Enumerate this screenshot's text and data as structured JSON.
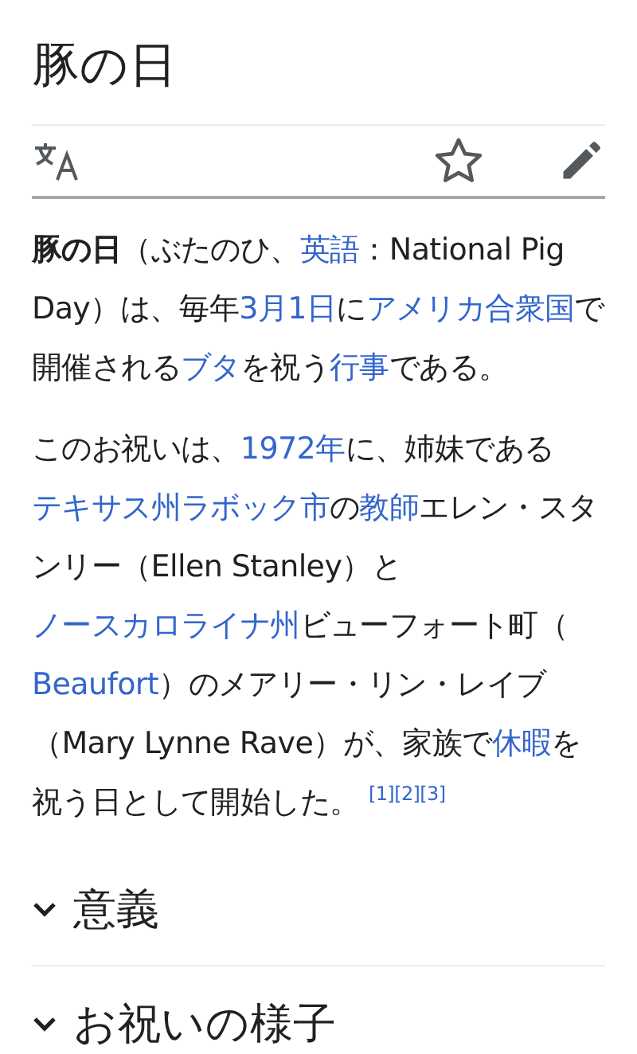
{
  "page_title": "豚の日",
  "toolbar": {
    "star": {
      "selected": false
    }
  },
  "paragraphs": [
    [
      {
        "kind": "bold",
        "text": "豚の日"
      },
      {
        "kind": "plain",
        "text": "（ぶたのひ、"
      },
      {
        "kind": "link",
        "text": "英語"
      },
      {
        "kind": "plain",
        "text": "：National Pig Day）は、毎年"
      },
      {
        "kind": "link",
        "text": "3月1日"
      },
      {
        "kind": "plain",
        "text": "に"
      },
      {
        "kind": "link",
        "text": "アメリカ合衆国"
      },
      {
        "kind": "plain",
        "text": "で開催される"
      },
      {
        "kind": "link",
        "text": "ブタ"
      },
      {
        "kind": "plain",
        "text": "を祝う"
      },
      {
        "kind": "link",
        "text": "行事"
      },
      {
        "kind": "plain",
        "text": "である。"
      }
    ],
    [
      {
        "kind": "plain",
        "text": "このお祝いは、"
      },
      {
        "kind": "link",
        "text": "1972年"
      },
      {
        "kind": "plain",
        "text": "に、姉妹である"
      },
      {
        "kind": "link",
        "text": "テキサス州"
      },
      {
        "kind": "link",
        "text": "ラボック市"
      },
      {
        "kind": "plain",
        "text": "の"
      },
      {
        "kind": "link",
        "text": "教師"
      },
      {
        "kind": "plain",
        "text": "エレン・スタンリー（Ellen Stanley）と"
      },
      {
        "kind": "link",
        "text": "ノースカロライナ州"
      },
      {
        "kind": "plain",
        "text": "ビューフォート町（ "
      },
      {
        "kind": "link",
        "text": "Beaufort"
      },
      {
        "kind": "plain",
        "text": "）のメアリー・リン・レイブ（Mary Lynne Rave）が、家族で"
      },
      {
        "kind": "link",
        "text": "休暇"
      },
      {
        "kind": "plain",
        "text": "を祝う日として開始した。 "
      },
      {
        "kind": "ref",
        "text": "[1]"
      },
      {
        "kind": "ref",
        "text": "[2]"
      },
      {
        "kind": "ref",
        "text": "[3]"
      }
    ]
  ],
  "sections": [
    {
      "title": "意義",
      "expanded": false
    },
    {
      "title": "お祝いの様子",
      "expanded": false
    }
  ]
}
